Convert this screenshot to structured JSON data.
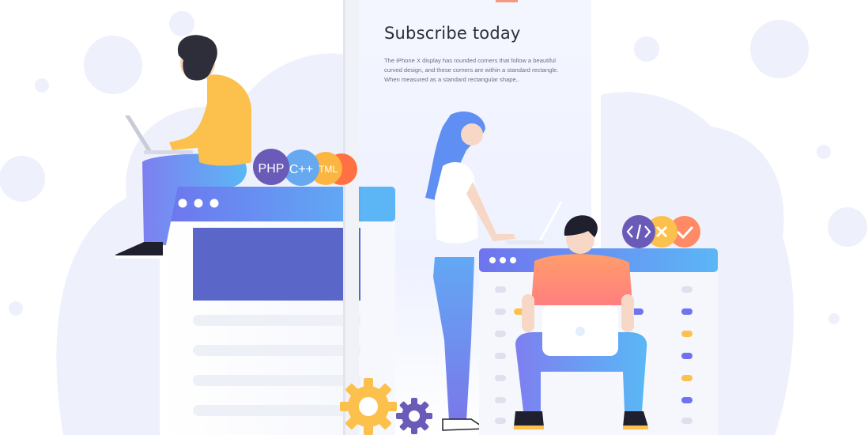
{
  "phone": {
    "title": "Subscribe today",
    "body": "The iPhone X display has rounded corners that follow a beautiful curved design, and these corners are within a standard rectangle. When measured as a standard rectangular shape,."
  },
  "badges": {
    "php": "PHP",
    "cpp": "C++",
    "html": "TML"
  },
  "colors": {
    "accent_blue": "#5b8cf6",
    "panel_indigo": "#5a67c9",
    "purple": "#6a5bb8",
    "yellow": "#fbc14c",
    "orange": "#ff8a65",
    "background_blob": "#eef1fb"
  },
  "icons": [
    "code-icon",
    "close-icon",
    "check-icon",
    "gear-icon"
  ]
}
